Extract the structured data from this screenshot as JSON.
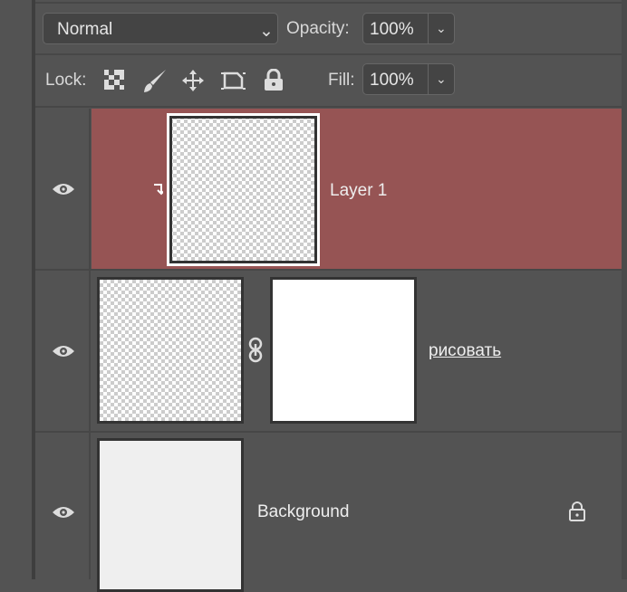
{
  "toolbar": {
    "blend_mode": "Normal",
    "opacity_label": "Opacity:",
    "opacity_value": "100%",
    "lock_label": "Lock:",
    "fill_label": "Fill:",
    "fill_value": "100%"
  },
  "lock_icons": [
    "lock-transparent-pixels-icon",
    "lock-image-pixels-icon",
    "lock-position-icon",
    "lock-artboard-icon",
    "lock-all-icon"
  ],
  "layers": [
    {
      "name": "Layer 1",
      "selected": true,
      "clipped": true
    },
    {
      "name": "рисовать",
      "has_mask": true
    },
    {
      "name": "Background",
      "locked": true
    }
  ],
  "colors": {
    "selected_row": "#965454",
    "panel": "#535353"
  }
}
